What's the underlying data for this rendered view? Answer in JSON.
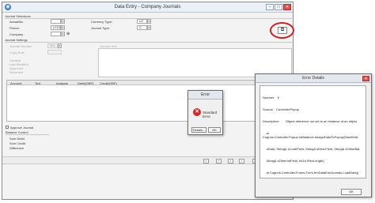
{
  "main_window": {
    "title": "Data Entry - Company Journals",
    "controls": {
      "minimize": "–",
      "maximize": "□",
      "close": "✕"
    }
  },
  "journal_selections": {
    "header": "Journal Selections",
    "actual_label": "Actual/Bu",
    "period_label": "Period:",
    "period_value": "LY12",
    "company_label": "Company",
    "currency_type_label": "Currency Type:",
    "currency_type_value": "LC",
    "journal_type_label": "Journal Type:",
    "journal_type_value": "C"
  },
  "journal_settings": {
    "header": "Journal Settings",
    "journal_number_label": "Journal Number",
    "journal_number_value": "001",
    "copy_rule_label": "Copy Rule",
    "created_label": "Created",
    "last_modified_label": "Last Modified",
    "approved_label": "Approved",
    "reversed_label": "Reversed",
    "journal_text_label": "Journal Text"
  },
  "grid": {
    "columns": [
      "Account",
      "Text",
      "Analysis",
      "Debit(GBP)",
      "Credit(GBP)"
    ]
  },
  "approve_journal_label": "Approve Journal",
  "balance_control": {
    "header": "Balance Control",
    "sum_debit": "Sum Debit",
    "sum_credit": "Sum Credit",
    "difference": "Difference"
  },
  "error_dialog": {
    "title": "Error",
    "message": "Standard Error",
    "details_button": "Details...",
    "ok_button": "OK"
  },
  "error_details": {
    "title": "Error Details",
    "number_line": "Number:   5",
    "source_line": "Source:   ControllerPopup",
    "description_line": "Description:       Object reference not set to an instance of an object",
    "trace_1": "    at Cognos.Controller.Popup.strBalance.AssignDataToPopup(DataSet&",
    "trace_2": "    oData, String& sCodeField, String& sDescField, String& sOtherBal,",
    "trace_3": "    String& sOtherIntField, Int16 iRecLength)",
    "trace_4": "    at Cognos.Controller.Forms.Form.frmDataEntJournals.LoadData()",
    "ok_button": "OK"
  },
  "colors": {
    "highlight_ring": "#cc2020",
    "error_icon": "#d02828"
  }
}
